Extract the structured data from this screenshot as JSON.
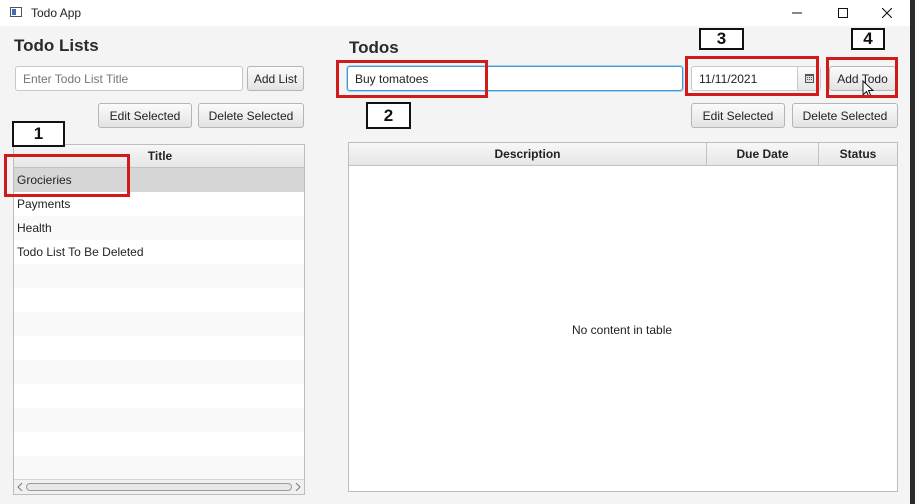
{
  "window": {
    "title": "Todo App"
  },
  "todo_lists": {
    "heading": "Todo Lists",
    "title_input": {
      "placeholder": "Enter Todo List Title",
      "value": ""
    },
    "add_button": "Add List",
    "edit_button": "Edit Selected",
    "delete_button": "Delete Selected",
    "table": {
      "header": "Title",
      "rows": [
        "Grocieries",
        "Payments",
        "Health",
        "Todo List To Be Deleted"
      ],
      "selected_row": "Grocieries"
    }
  },
  "todos": {
    "heading": "Todos",
    "description_input": {
      "value": "Buy tomatoes"
    },
    "date_input": {
      "value": "11/11/2021"
    },
    "add_button": "Add Todo",
    "edit_button": "Edit Selected",
    "delete_button": "Delete Selected",
    "table": {
      "headers": [
        "Description",
        "Due Date",
        "Status"
      ],
      "empty_message": "No content in table"
    }
  },
  "annotations": {
    "callouts": [
      "1",
      "2",
      "3",
      "4"
    ],
    "color": "#d11a1a"
  },
  "icons": [
    "app-icon",
    "minimize-icon",
    "maximize-icon",
    "close-icon",
    "calendar-icon",
    "mouse-cursor-icon"
  ]
}
